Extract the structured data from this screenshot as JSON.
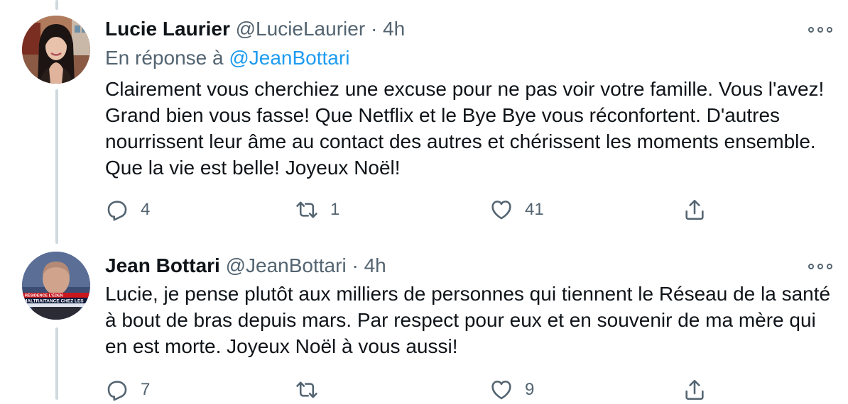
{
  "tweets": [
    {
      "name": "Lucie Laurier",
      "handle": "@LucieLaurier",
      "separator": "·",
      "time": "4h",
      "reply_prefix": "En réponse à",
      "reply_handle": "@JeanBottari",
      "text": "Clairement vous cherchiez une excuse pour ne pas voir votre famille. Vous l'avez! Grand bien vous fasse! Que Netflix et le Bye Bye vous réconfortent. D'autres nourrissent leur âme au contact des autres et chérissent les moments ensemble. Que la vie est belle! Joyeux Noël!",
      "replies": "4",
      "retweets": "1",
      "likes": "41"
    },
    {
      "name": "Jean Bottari",
      "handle": "@JeanBottari",
      "separator": "·",
      "time": "4h",
      "avatar_banner_top": "RÉSIDENCE L'ÉDEN",
      "avatar_banner_main": "MALTRAITANCE CHEZ LES",
      "text": "Lucie, je pense plutôt aux milliers de personnes qui tiennent le Réseau de la santé à bout de bras depuis mars. Par respect pour eux et en souvenir de ma mère qui en est morte. Joyeux Noël à vous aussi!",
      "replies": "7",
      "retweets": "",
      "likes": "9"
    }
  ],
  "icons": {
    "reply": "reply-icon",
    "retweet": "retweet-icon",
    "like": "heart-icon",
    "share": "share-icon",
    "more": "more-icon"
  },
  "colors": {
    "name": "#0f1419",
    "secondary": "#536471",
    "link": "#1d9bf0",
    "thread_line": "#cfd9de"
  }
}
